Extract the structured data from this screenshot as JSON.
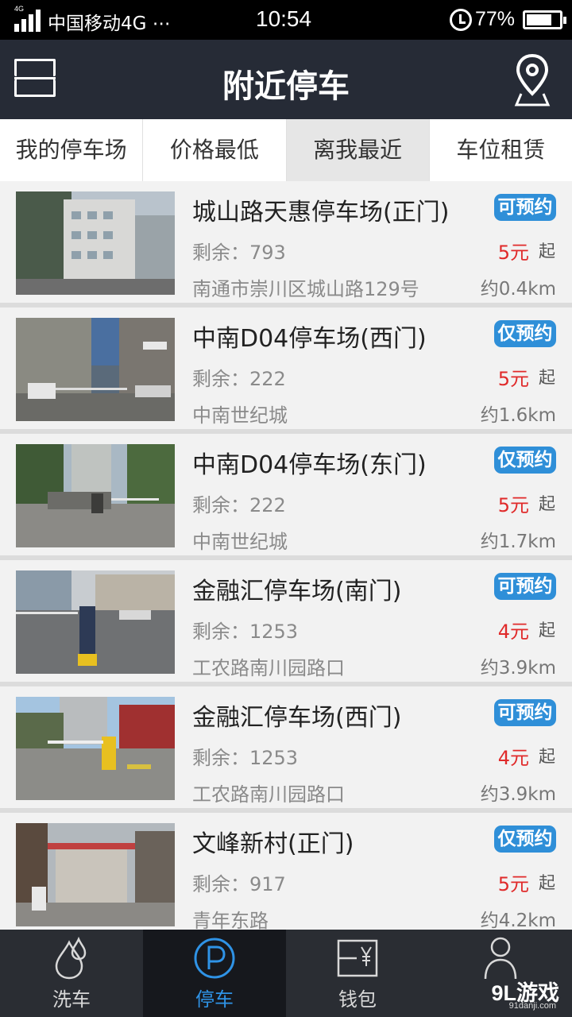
{
  "status_bar": {
    "network_tag": "4G",
    "carrier": "中国移动4G ⋯",
    "time": "10:54",
    "battery": "77%",
    "battery_level": 0.77
  },
  "header": {
    "title": "附近停车",
    "left_icon": "scan-frame-icon",
    "right_icon": "map-pin-icon"
  },
  "tabs": [
    {
      "label": "我的停车场"
    },
    {
      "label": "价格最低"
    },
    {
      "label": "离我最近",
      "active": true
    },
    {
      "label": "车位租赁"
    }
  ],
  "parking_list": [
    {
      "name": "城山路天惠停车场(正门)",
      "badge": "可预约",
      "remaining": "剩余：793",
      "price": "5元",
      "price_suffix": "起",
      "address": "南通市崇川区城山路129号",
      "distance": "约0.4km"
    },
    {
      "name": "中南D04停车场(西门)",
      "badge": "仅预约",
      "remaining": "剩余：222",
      "price": "5元",
      "price_suffix": "起",
      "address": "中南世纪城",
      "distance": "约1.6km"
    },
    {
      "name": "中南D04停车场(东门)",
      "badge": "仅预约",
      "remaining": "剩余：222",
      "price": "5元",
      "price_suffix": "起",
      "address": "中南世纪城",
      "distance": "约1.7km"
    },
    {
      "name": "金融汇停车场(南门)",
      "badge": "可预约",
      "remaining": "剩余：1253",
      "price": "4元",
      "price_suffix": "起",
      "address": "工农路南川园路口",
      "distance": "约3.9km"
    },
    {
      "name": "金融汇停车场(西门)",
      "badge": "可预约",
      "remaining": "剩余：1253",
      "price": "4元",
      "price_suffix": "起",
      "address": "工农路南川园路口",
      "distance": "约3.9km"
    },
    {
      "name": "文峰新村(正门)",
      "badge": "仅预约",
      "remaining": "剩余：917",
      "price": "5元",
      "price_suffix": "起",
      "address": "青年东路",
      "distance": "约4.2km"
    }
  ],
  "bottom_nav": [
    {
      "label": "洗车",
      "icon": "car-wash-drops-icon"
    },
    {
      "label": "停车",
      "icon": "parking-p-icon",
      "active": true
    },
    {
      "label": "钱包",
      "icon": "wallet-yen-icon"
    },
    {
      "label": "",
      "icon": "user-profile-icon"
    }
  ],
  "watermark": {
    "brand": "9L游戏",
    "domain": "91danji.com"
  },
  "colors": {
    "header_bg": "#262b36",
    "accent_blue": "#2f93e6",
    "badge_blue": "#2f8fd8",
    "price_red": "#e02a2a",
    "nav_bg": "#2a2d33"
  }
}
